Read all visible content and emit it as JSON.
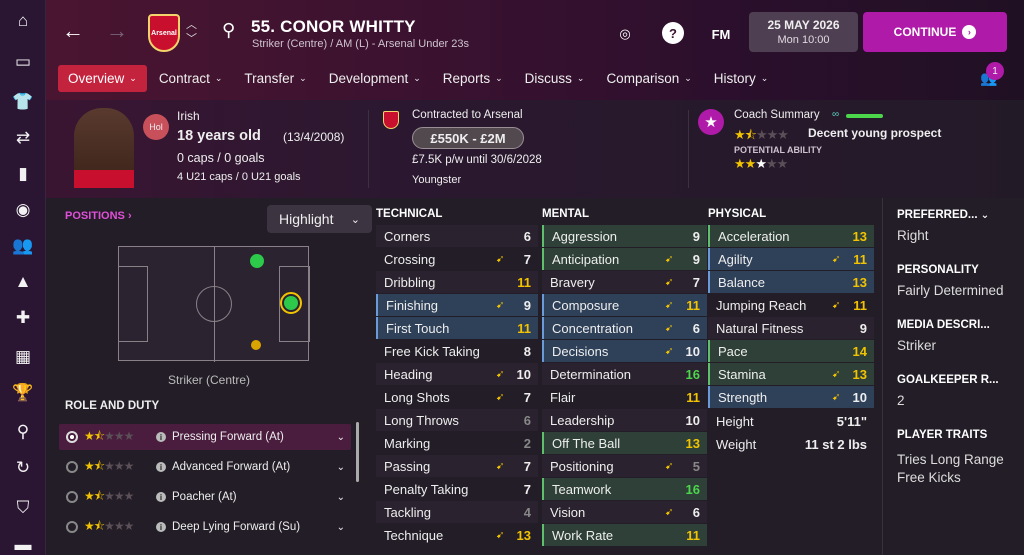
{
  "player": {
    "name": "55. CONOR WHITTY",
    "subtitle": "Striker (Centre) / AM (L) - Arsenal Under 23s",
    "nationality": "Irish",
    "nat_code": "Hol",
    "age": "18 years old",
    "dob": "(13/4/2008)",
    "caps": "0 caps / 0 goals",
    "u21": "4 U21 caps / 0 U21 goals"
  },
  "club": {
    "crest_text": "Arsenal"
  },
  "contract": {
    "title": "Contracted to Arsenal",
    "value": "£550K - £2M",
    "wage": "£7.5K p/w until 30/6/2028",
    "status": "Youngster"
  },
  "coach": {
    "title": "Coach Summary",
    "verdict": "Decent young prospect",
    "potential_label": "POTENTIAL ABILITY"
  },
  "date": {
    "day": "25 MAY 2026",
    "time": "Mon 10:00"
  },
  "buttons": {
    "continue": "CONTINUE",
    "fm": "FM",
    "notifications": "1"
  },
  "tabs": [
    {
      "label": "Overview"
    },
    {
      "label": "Contract"
    },
    {
      "label": "Transfer"
    },
    {
      "label": "Development"
    },
    {
      "label": "Reports"
    },
    {
      "label": "Discuss"
    },
    {
      "label": "Comparison"
    },
    {
      "label": "History"
    }
  ],
  "positions": {
    "title": "POSITIONS",
    "highlight": "Highlight",
    "label": "Striker (Centre)"
  },
  "roles": {
    "title": "ROLE AND DUTY",
    "items": [
      {
        "label": "Pressing Forward (At)"
      },
      {
        "label": "Advanced Forward (At)"
      },
      {
        "label": "Poacher (At)"
      },
      {
        "label": "Deep Lying Forward (Su)"
      }
    ]
  },
  "technical": {
    "title": "TECHNICAL",
    "items": [
      {
        "name": "Corners",
        "value": "6"
      },
      {
        "name": "Crossing",
        "value": "7"
      },
      {
        "name": "Dribbling",
        "value": "11"
      },
      {
        "name": "Finishing",
        "value": "9"
      },
      {
        "name": "First Touch",
        "value": "11"
      },
      {
        "name": "Free Kick Taking",
        "value": "8"
      },
      {
        "name": "Heading",
        "value": "10"
      },
      {
        "name": "Long Shots",
        "value": "7"
      },
      {
        "name": "Long Throws",
        "value": "6"
      },
      {
        "name": "Marking",
        "value": "2"
      },
      {
        "name": "Passing",
        "value": "7"
      },
      {
        "name": "Penalty Taking",
        "value": "7"
      },
      {
        "name": "Tackling",
        "value": "4"
      },
      {
        "name": "Technique",
        "value": "13"
      }
    ]
  },
  "mental": {
    "title": "MENTAL",
    "items": [
      {
        "name": "Aggression",
        "value": "9"
      },
      {
        "name": "Anticipation",
        "value": "9"
      },
      {
        "name": "Bravery",
        "value": "7"
      },
      {
        "name": "Composure",
        "value": "11"
      },
      {
        "name": "Concentration",
        "value": "6"
      },
      {
        "name": "Decisions",
        "value": "10"
      },
      {
        "name": "Determination",
        "value": "16"
      },
      {
        "name": "Flair",
        "value": "11"
      },
      {
        "name": "Leadership",
        "value": "10"
      },
      {
        "name": "Off The Ball",
        "value": "13"
      },
      {
        "name": "Positioning",
        "value": "5"
      },
      {
        "name": "Teamwork",
        "value": "16"
      },
      {
        "name": "Vision",
        "value": "6"
      },
      {
        "name": "Work Rate",
        "value": "11"
      }
    ]
  },
  "physical": {
    "title": "PHYSICAL",
    "items": [
      {
        "name": "Acceleration",
        "value": "13"
      },
      {
        "name": "Agility",
        "value": "11"
      },
      {
        "name": "Balance",
        "value": "13"
      },
      {
        "name": "Jumping Reach",
        "value": "11"
      },
      {
        "name": "Natural Fitness",
        "value": "9"
      },
      {
        "name": "Pace",
        "value": "14"
      },
      {
        "name": "Stamina",
        "value": "13"
      },
      {
        "name": "Strength",
        "value": "10"
      }
    ],
    "height_label": "Height",
    "height": "5'11\"",
    "weight_label": "Weight",
    "weight": "11 st 2 lbs"
  },
  "side": {
    "foot_title": "PREFERRED...",
    "foot": "Right",
    "personality_title": "PERSONALITY",
    "personality": "Fairly Determined",
    "media_title": "MEDIA DESCRI...",
    "media": "Striker",
    "gk_title": "GOALKEEPER R...",
    "gk": "2",
    "traits_title": "PLAYER TRAITS",
    "traits": "Tries Long Range Free Kicks"
  },
  "colors": {
    "accent": "#b01aa8",
    "tab_active": "#c4233e",
    "highlight_value": "#f2c300",
    "good_value": "#4cd64c"
  }
}
